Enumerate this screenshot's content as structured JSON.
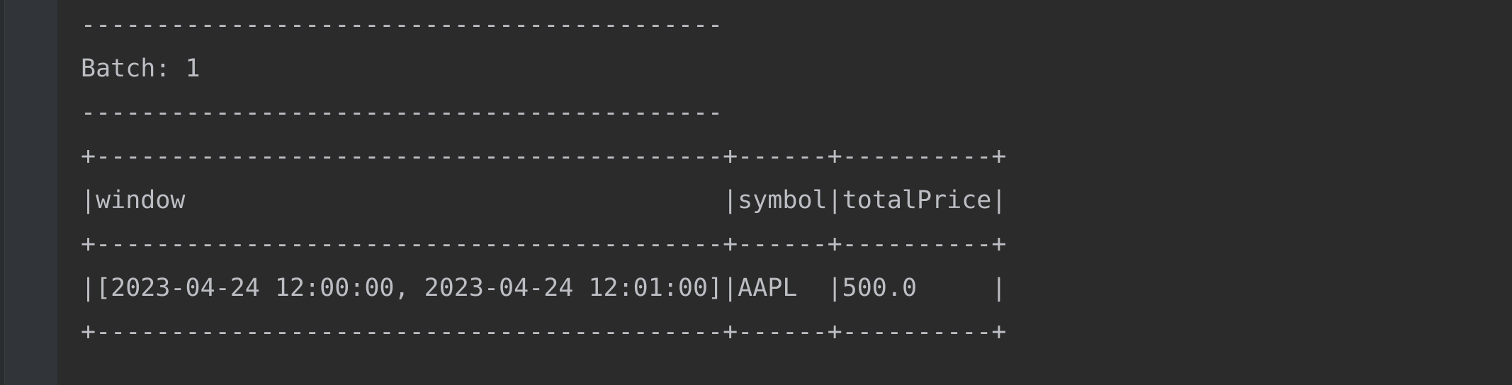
{
  "console": {
    "lines": [
      "-------------------------------------------",
      "Batch: 1",
      "-------------------------------------------",
      "+------------------------------------------+------+----------+",
      "|window                                    |symbol|totalPrice|",
      "+------------------------------------------+------+----------+",
      "|[2023-04-24 12:00:00, 2023-04-24 12:01:00]|AAPL  |500.0     |",
      "+------------------------------------------+------+----------+"
    ]
  }
}
